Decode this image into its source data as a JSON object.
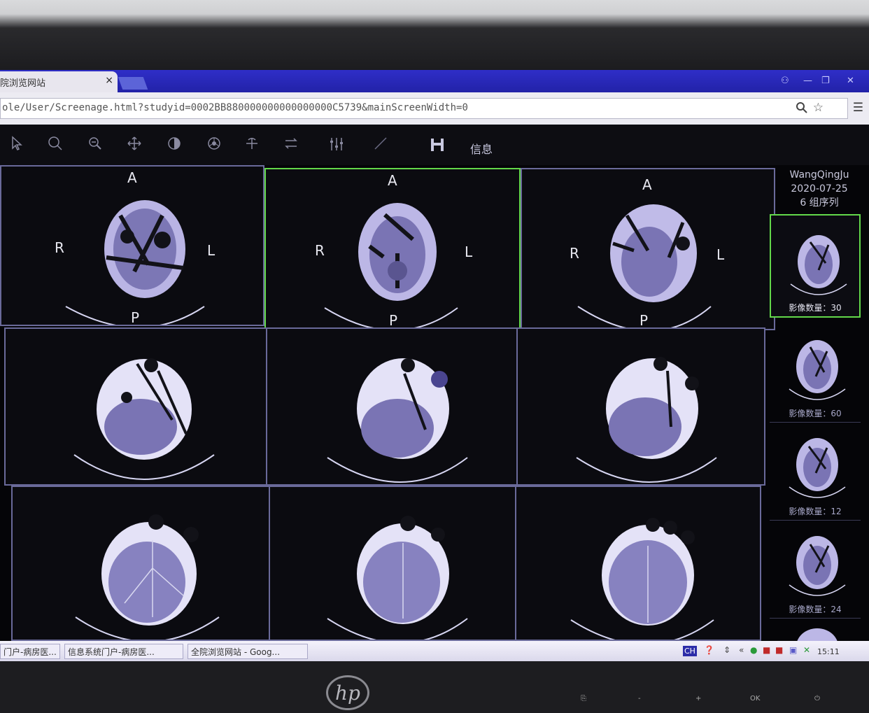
{
  "browser": {
    "tab_title": "院浏览网站",
    "tab_close": "×",
    "url": "ole/User/Screenage.html?studyid=0002BB880000000000000000C5739&mainScreenWidth=0"
  },
  "toolbar": {
    "info_label": "信息"
  },
  "viewer": {
    "orientation": {
      "anterior": "A",
      "posterior": "P",
      "right": "R",
      "left": "L"
    }
  },
  "series_panel": {
    "patient_name": "WangQingJu",
    "study_date": "2020-07-25",
    "series_summary": "6 组序列",
    "thumbnails": [
      {
        "count_label": "影像数量：30"
      },
      {
        "count_label": "影像数量：60"
      },
      {
        "count_label": "影像数量：12"
      },
      {
        "count_label": "影像数量：24"
      }
    ]
  },
  "taskbar": {
    "items": [
      {
        "label": "门户-病房医..."
      },
      {
        "label": "信息系统门户-病房医..."
      },
      {
        "label": "全院浏览网站 - Goog..."
      }
    ],
    "ime": "CH",
    "clock": "15:11"
  },
  "monitor": {
    "brand": "hp",
    "buttons": [
      "",
      "-",
      "+",
      "OK",
      ""
    ]
  },
  "colors": {
    "active_border": "#63d84a",
    "cell_border": "#6a6a9a",
    "tab_bar": "#2f2ec8"
  }
}
